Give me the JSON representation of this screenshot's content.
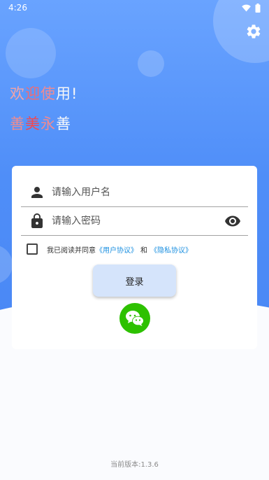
{
  "status_bar": {
    "time": "4:26",
    "icons": [
      "wifi-icon",
      "battery-icon"
    ]
  },
  "header": {
    "settings_icon": "gear-icon",
    "welcome_chars": [
      "欢",
      "迎",
      "使",
      "用",
      "!"
    ],
    "welcome_colors": [
      "#f3a3a6",
      "#ef6b73",
      "#f08a91",
      "#f7f7f7",
      "#f7f7f7"
    ],
    "slogan_chars": [
      "善",
      "美",
      "永",
      "善"
    ],
    "slogan_colors": [
      "#f38c8c",
      "#f2484f",
      "#f08a91",
      "#fafafa"
    ]
  },
  "form": {
    "username_placeholder": "请输入用户名",
    "password_placeholder": "请输入密码",
    "agree_text": "我已阅读并同意",
    "user_agreement": "《用户协议》",
    "and_text": "和",
    "privacy_agreement": "《隐私协议》",
    "login_label": "登录"
  },
  "footer": {
    "version": "当前版本:1.3.6"
  },
  "colors": {
    "hero_gradient": [
      "#69a3ff",
      "#4a88f5"
    ],
    "link": "#1a8fe0",
    "login_button_bg": "#d5e4fb",
    "wechat_green": "#2dc100"
  }
}
